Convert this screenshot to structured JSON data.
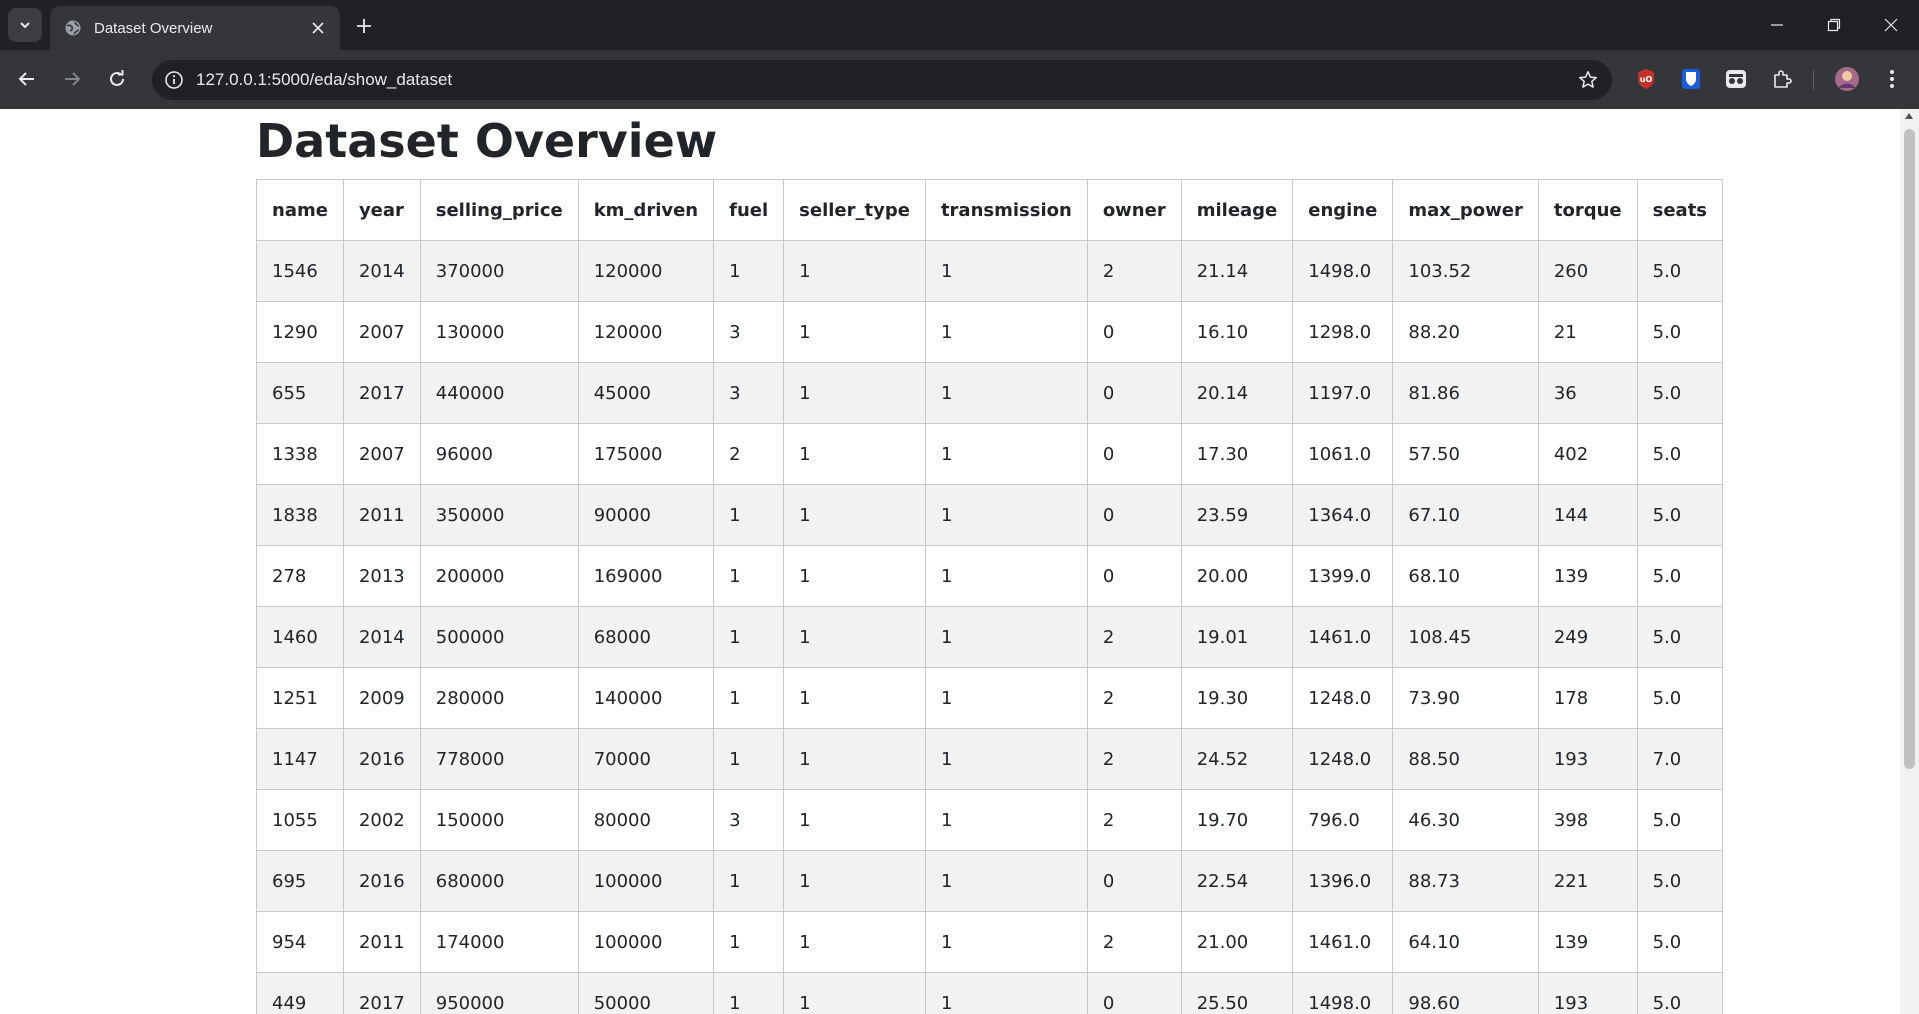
{
  "browser": {
    "tab_title": "Dataset Overview",
    "url": "127.0.0.1:5000/eda/show_dataset"
  },
  "page": {
    "title": "Dataset Overview"
  },
  "table": {
    "columns": [
      "name",
      "year",
      "selling_price",
      "km_driven",
      "fuel",
      "seller_type",
      "transmission",
      "owner",
      "mileage",
      "engine",
      "max_power",
      "torque",
      "seats"
    ],
    "rows": [
      [
        "1546",
        "2014",
        "370000",
        "120000",
        "1",
        "1",
        "1",
        "2",
        "21.14",
        "1498.0",
        "103.52",
        "260",
        "5.0"
      ],
      [
        "1290",
        "2007",
        "130000",
        "120000",
        "3",
        "1",
        "1",
        "0",
        "16.10",
        "1298.0",
        "88.20",
        "21",
        "5.0"
      ],
      [
        "655",
        "2017",
        "440000",
        "45000",
        "3",
        "1",
        "1",
        "0",
        "20.14",
        "1197.0",
        "81.86",
        "36",
        "5.0"
      ],
      [
        "1338",
        "2007",
        "96000",
        "175000",
        "2",
        "1",
        "1",
        "0",
        "17.30",
        "1061.0",
        "57.50",
        "402",
        "5.0"
      ],
      [
        "1838",
        "2011",
        "350000",
        "90000",
        "1",
        "1",
        "1",
        "0",
        "23.59",
        "1364.0",
        "67.10",
        "144",
        "5.0"
      ],
      [
        "278",
        "2013",
        "200000",
        "169000",
        "1",
        "1",
        "1",
        "0",
        "20.00",
        "1399.0",
        "68.10",
        "139",
        "5.0"
      ],
      [
        "1460",
        "2014",
        "500000",
        "68000",
        "1",
        "1",
        "1",
        "2",
        "19.01",
        "1461.0",
        "108.45",
        "249",
        "5.0"
      ],
      [
        "1251",
        "2009",
        "280000",
        "140000",
        "1",
        "1",
        "1",
        "2",
        "19.30",
        "1248.0",
        "73.90",
        "178",
        "5.0"
      ],
      [
        "1147",
        "2016",
        "778000",
        "70000",
        "1",
        "1",
        "1",
        "2",
        "24.52",
        "1248.0",
        "88.50",
        "193",
        "7.0"
      ],
      [
        "1055",
        "2002",
        "150000",
        "80000",
        "3",
        "1",
        "1",
        "2",
        "19.70",
        "796.0",
        "46.30",
        "398",
        "5.0"
      ],
      [
        "695",
        "2016",
        "680000",
        "100000",
        "1",
        "1",
        "1",
        "0",
        "22.54",
        "1396.0",
        "88.73",
        "221",
        "5.0"
      ],
      [
        "954",
        "2011",
        "174000",
        "100000",
        "1",
        "1",
        "1",
        "2",
        "21.00",
        "1461.0",
        "64.10",
        "139",
        "5.0"
      ],
      [
        "449",
        "2017",
        "950000",
        "50000",
        "1",
        "1",
        "1",
        "0",
        "25.50",
        "1498.0",
        "98.60",
        "193",
        "5.0"
      ]
    ]
  },
  "icons": {
    "tab_list": "chevron-down-icon",
    "tab_favicon": "globe-icon",
    "tab_close": "close-icon",
    "new_tab": "plus-icon",
    "back": "arrow-left-icon",
    "forward": "arrow-right-icon",
    "reload": "reload-icon",
    "site_info": "info-icon",
    "bookmark": "star-icon",
    "extensions": "puzzle-icon",
    "profile": "avatar",
    "menu": "kebab-menu-icon"
  },
  "colors": {
    "chrome_dark": "#202124",
    "chrome_toolbar": "#35363a",
    "row_stripe": "#f2f2f2",
    "ublock_red": "#c4302b",
    "bitwarden_blue": "#175ddc"
  }
}
